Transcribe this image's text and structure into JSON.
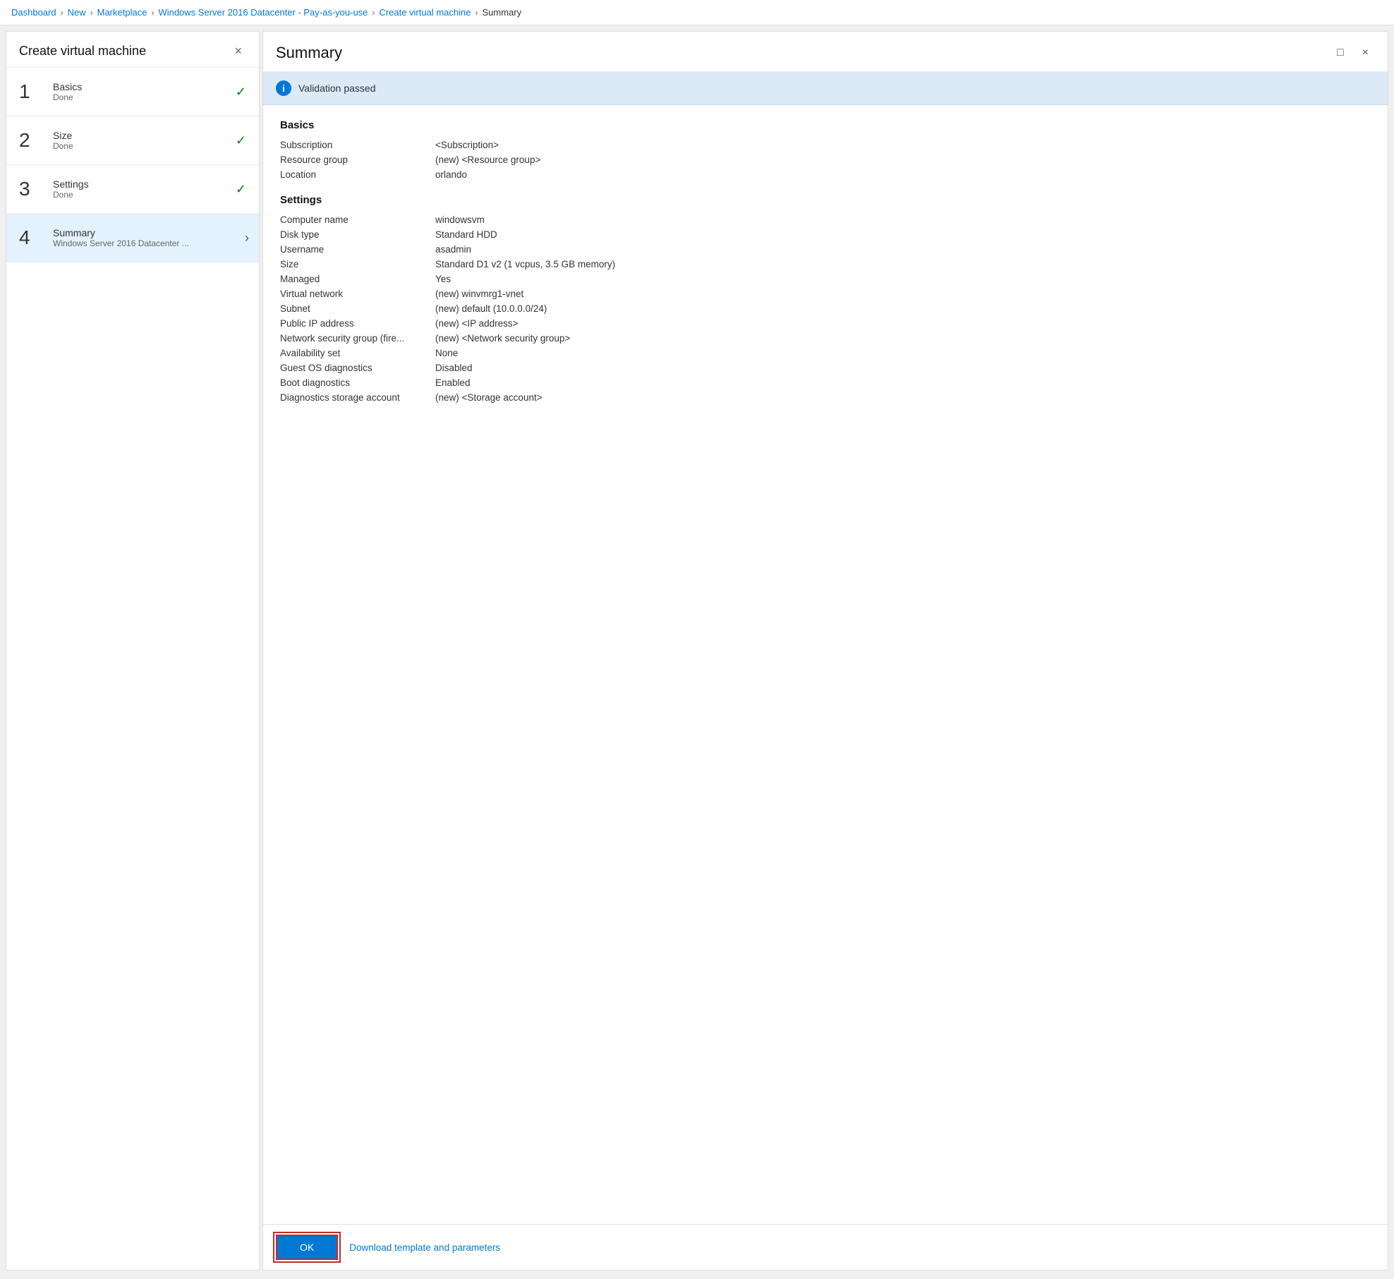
{
  "breadcrumb": {
    "items": [
      {
        "label": "Dashboard",
        "href": true
      },
      {
        "label": "New",
        "href": true
      },
      {
        "label": "Marketplace",
        "href": true
      },
      {
        "label": "Windows Server 2016 Datacenter - Pay-as-you-use",
        "href": true
      },
      {
        "label": "Create virtual machine",
        "href": true
      },
      {
        "label": "Summary",
        "href": false
      }
    ]
  },
  "left_panel": {
    "title": "Create virtual machine",
    "close_label": "×",
    "steps": [
      {
        "number": "1",
        "name": "Basics",
        "status": "Done",
        "done": true,
        "active": false
      },
      {
        "number": "2",
        "name": "Size",
        "status": "Done",
        "done": true,
        "active": false
      },
      {
        "number": "3",
        "name": "Settings",
        "status": "Done",
        "done": true,
        "active": false
      },
      {
        "number": "4",
        "name": "Summary",
        "status": "Windows Server 2016 Datacenter ...",
        "done": false,
        "active": true
      }
    ]
  },
  "right_panel": {
    "title": "Summary",
    "maximize_label": "□",
    "close_label": "×",
    "validation": {
      "icon": "i",
      "text": "Validation passed"
    },
    "basics_section": {
      "title": "Basics",
      "rows": [
        {
          "label": "Subscription",
          "value": "<Subscription>"
        },
        {
          "label": "Resource group",
          "value": "(new) <Resource group>"
        },
        {
          "label": "Location",
          "value": "orlando"
        }
      ]
    },
    "settings_section": {
      "title": "Settings",
      "rows": [
        {
          "label": "Computer name",
          "value": "windowsvm"
        },
        {
          "label": "Disk type",
          "value": "Standard HDD"
        },
        {
          "label": "Username",
          "value": "asadmin"
        },
        {
          "label": "Size",
          "value": "Standard D1 v2 (1 vcpus, 3.5 GB memory)"
        },
        {
          "label": "Managed",
          "value": "Yes"
        },
        {
          "label": "Virtual network",
          "value": "(new) winvmrg1-vnet"
        },
        {
          "label": "Subnet",
          "value": "(new) default (10.0.0.0/24)"
        },
        {
          "label": "Public IP address",
          "value": "(new) <IP address>"
        },
        {
          "label": "Network security group (fire...",
          "value": "(new) <Network security group>"
        },
        {
          "label": "Availability set",
          "value": "None"
        },
        {
          "label": "Guest OS diagnostics",
          "value": "Disabled"
        },
        {
          "label": "Boot diagnostics",
          "value": "Enabled"
        },
        {
          "label": "Diagnostics storage account",
          "value": "(new) <Storage account>"
        }
      ]
    },
    "bottom": {
      "ok_label": "OK",
      "download_label": "Download template and parameters"
    }
  }
}
